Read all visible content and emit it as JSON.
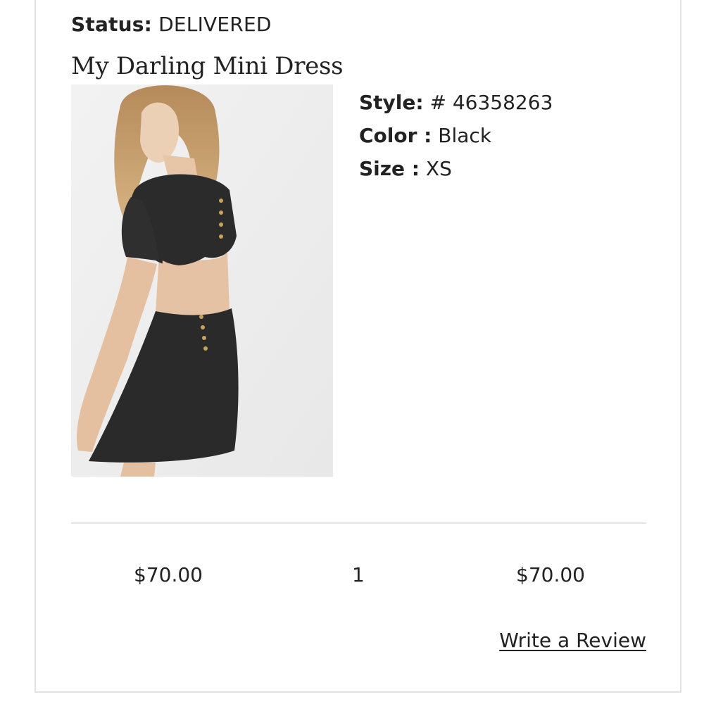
{
  "order_item": {
    "status_label": "Status:",
    "status_value": "DELIVERED",
    "product_name": "My Darling Mini Dress",
    "image_alt": "Model wearing black open-back mini dress with gold buttons",
    "style_label": "Style:",
    "style_value": "# 46358263",
    "color_label": "Color :",
    "color_value": "Black",
    "size_label": "Size :",
    "size_value": "XS",
    "price": "$70.00",
    "quantity": "1",
    "total": "$70.00",
    "review_link": "Write a Review"
  },
  "colors": {
    "text": "#222222",
    "border": "#e2e2e2",
    "image_bg": "#efefef",
    "dress": "#2b2b2b",
    "hair": "#c9a070",
    "skin": "#e9c9ad"
  }
}
